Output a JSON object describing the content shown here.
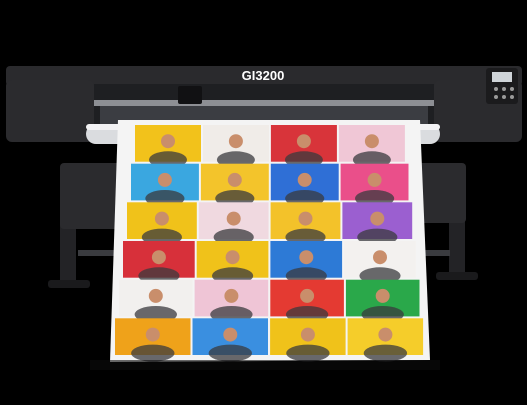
{
  "printer": {
    "model_label": "GI3200"
  },
  "colors": {
    "background": "#000000",
    "body": "#2b2b2e",
    "body_dark": "#161618",
    "rail": "#8d8f94",
    "media": "#f4f4f4",
    "tile_palette": [
      "#e23b2e",
      "#f2c21b",
      "#2f6fd6",
      "#ea6aa6",
      "#27a84a",
      "#f28c1e",
      "#7e4fc7",
      "#1bb3c9",
      "#d9d9dc"
    ]
  },
  "print_grid": {
    "rows": 6,
    "cols": 4,
    "tiles": [
      [
        "#f2c21b",
        "#f0ece8",
        "#d8343a",
        "#f0c7d6"
      ],
      [
        "#3aa7e0",
        "#f3c42b",
        "#2f6fd6",
        "#ea4f8a"
      ],
      [
        "#f0c21a",
        "#f0d9e0",
        "#f3c22a",
        "#9b5fd0"
      ],
      [
        "#d7303a",
        "#f0c21a",
        "#2d7ad6",
        "#f3f1ef"
      ],
      [
        "#f2f0ee",
        "#efc5d6",
        "#e43a32",
        "#2aa84a"
      ],
      [
        "#efa21a",
        "#3a8fe0",
        "#f0c21a",
        "#f5cd2a"
      ]
    ]
  }
}
